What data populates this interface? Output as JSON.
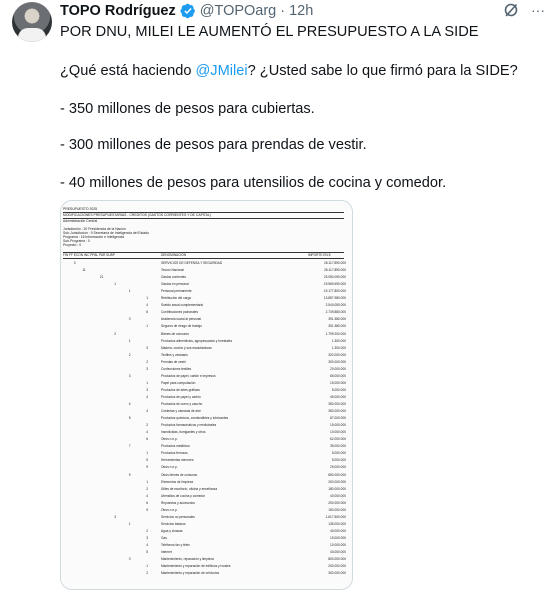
{
  "tweet": {
    "author_name": "TOPO Rodríguez",
    "handle": "@TOPOarg",
    "separator": "·",
    "time": "12h",
    "more_label": "···",
    "text": {
      "line1": "POR DNU, MILEI LE AUMENTÓ EL PRESUPUESTO A LA SIDE",
      "line2_a": "¿Qué está haciendo ",
      "line2_mention": "@JMilei",
      "line2_b": "? ¿Usted sabe lo que firmó para la SIDE?",
      "line3": "- 350 millones de pesos para cubiertas.",
      "line4": "- 300 millones de pesos para prendas de vestir.",
      "line5": "- 40 millones de pesos para utensilios de cocina y comedor."
    },
    "colors": {
      "mention": "#1d9bf0",
      "verified": "#1d9bf0",
      "muted": "#536471"
    }
  },
  "document": {
    "header": {
      "title": "PRESUPUESTO 2025",
      "subtitle": "MODIFICACIONES PRESUPUESTARIAS - CREDITOS (GASTOS CORRIENTES Y DE CAPITAL)",
      "admin": "Administración Central",
      "jurisdiccion": "Jurisdicción          :   20 Presidencia de la Nación",
      "subjurisdiccion": "Sub-Jurisdicción      :     9 Secretaría de Inteligencia del Estado",
      "programa": "Programa              :   16 Información e Inteligencia",
      "subprograma": "Sub-Programa          :     0",
      "proyecto": "Proyecto              :     0"
    },
    "columns": {
      "codes": "FIN  FF  ECON  INC  PPAL  PAR  SUBP",
      "denominacion": "DENOMINACIÓN",
      "importe": "IMPORTE EN $"
    },
    "rows": [
      {
        "code": "3",
        "indent": 6,
        "desc": "SERVICIOS DE DEFENSA Y SEGURIDAD",
        "amt": "26.117.890.000"
      },
      {
        "code": "11",
        "indent": 12,
        "desc": "Tesoro Nacional",
        "amt": "26.117.890.000"
      },
      {
        "code": "21",
        "indent": 24,
        "desc": "Gastos corrientes",
        "amt": "23.050.090.000"
      },
      {
        "code": "1",
        "indent": 34,
        "desc": "Gastos en personal",
        "amt": "19.569.690.000"
      },
      {
        "code": "1",
        "indent": 44,
        "desc": "Personal permanente",
        "amt": "19.177.800.000"
      },
      {
        "code": "1",
        "indent": 56,
        "desc": "Retribución del cargo",
        "amt": "13.857.980.000"
      },
      {
        "code": "4",
        "indent": 56,
        "desc": "Sueldo anual complementario",
        "amt": "2.540.050.000"
      },
      {
        "code": "6",
        "indent": 56,
        "desc": "Contribuciones patronales",
        "amt": "2.739.880.000"
      },
      {
        "code": "3",
        "indent": 44,
        "desc": "Asistencia social al personal",
        "amt": "391.380.000"
      },
      {
        "code": "1",
        "indent": 56,
        "desc": "Seguros de riesgo de trabajo",
        "amt": "391.380.000"
      },
      {
        "code": "2",
        "indent": 34,
        "desc": "Bienes de consumo",
        "amt": "1.799.200.000"
      },
      {
        "code": "1",
        "indent": 44,
        "desc": "Productos alimenticios, agropecuarios y forestales",
        "amt": "1.300.000"
      },
      {
        "code": "3",
        "indent": 56,
        "desc": "Madera, corcho y sus manufacturas",
        "amt": "1.300.000"
      },
      {
        "code": "2",
        "indent": 44,
        "desc": "Textiles y vestuario",
        "amt": "320.000.000"
      },
      {
        "code": "2",
        "indent": 56,
        "desc": "Prendas de vestir",
        "amt": "300.000.000"
      },
      {
        "code": "3",
        "indent": 56,
        "desc": "Confecciones textiles",
        "amt": "20.000.000"
      },
      {
        "code": "3",
        "indent": 44,
        "desc": "Productos de papel, cartón e impresos",
        "amt": "65.000.000"
      },
      {
        "code": "1",
        "indent": 56,
        "desc": "Papel para computación",
        "amt": "15.000.000"
      },
      {
        "code": "3",
        "indent": 56,
        "desc": "Productos de artes gráficas",
        "amt": "5.000.000"
      },
      {
        "code": "4",
        "indent": 56,
        "desc": "Productos de papel y cartón",
        "amt": "45.000.000"
      },
      {
        "code": "4",
        "indent": 44,
        "desc": "Productos de cuero y caucho",
        "amt": "350.000.000"
      },
      {
        "code": "4",
        "indent": 56,
        "desc": "Cubiertas y cámaras de aire",
        "amt": "350.000.000"
      },
      {
        "code": "5",
        "indent": 44,
        "desc": "Productos químicos, combustibles y lubricantes",
        "amt": "87.000.000"
      },
      {
        "code": "2",
        "indent": 56,
        "desc": "Productos farmacéuticos y medicinales",
        "amt": "15.000.000"
      },
      {
        "code": "4",
        "indent": 56,
        "desc": "Insecticidas, fumigantes y otros",
        "amt": "10.000.000"
      },
      {
        "code": "6",
        "indent": 56,
        "desc": "Otros n.e.p.",
        "amt": "62.000.000"
      },
      {
        "code": "7",
        "indent": 44,
        "desc": "Productos metálicos",
        "amt": "35.000.000"
      },
      {
        "code": "1",
        "indent": 56,
        "desc": "Productos ferrosos",
        "amt": "5.000.000"
      },
      {
        "code": "5",
        "indent": 56,
        "desc": "Herramientas menores",
        "amt": "5.000.000"
      },
      {
        "code": "9",
        "indent": 56,
        "desc": "Otros n.e.p.",
        "amt": "25.000.000"
      },
      {
        "code": "9",
        "indent": 44,
        "desc": "Otros bienes de consumo",
        "amt": "650.000.000"
      },
      {
        "code": "1",
        "indent": 56,
        "desc": "Elementos de limpieza",
        "amt": "200.000.000"
      },
      {
        "code": "2",
        "indent": 56,
        "desc": "Útiles de escritorio, oficina y enseñanza",
        "amt": "180.000.000"
      },
      {
        "code": "4",
        "indent": 56,
        "desc": "Utensilios de cocina y comedor",
        "amt": "40.000.000"
      },
      {
        "code": "6",
        "indent": 56,
        "desc": "Repuestos y accesorios",
        "amt": "200.000.000"
      },
      {
        "code": "9",
        "indent": 56,
        "desc": "Otros n.e.p.",
        "amt": "150.000.000"
      },
      {
        "code": "3",
        "indent": 34,
        "desc": "Servicios no personales",
        "amt": "1.617.500.000"
      },
      {
        "code": "1",
        "indent": 44,
        "desc": "Servicios básicos",
        "amt": "135.000.000"
      },
      {
        "code": "2",
        "indent": 56,
        "desc": "Agua y cloacas",
        "amt": "40.000.000"
      },
      {
        "code": "3",
        "indent": 56,
        "desc": "Gas",
        "amt": "15.000.000"
      },
      {
        "code": "4",
        "indent": 56,
        "desc": "Teléfonos fax y télex",
        "amt": "10.000.000"
      },
      {
        "code": "5",
        "indent": 56,
        "desc": "Internet",
        "amt": "40.000.000"
      },
      {
        "code": "3",
        "indent": 44,
        "desc": "Mantenimiento, reparación y limpieza",
        "amt": "800.000.000"
      },
      {
        "code": "1",
        "indent": 56,
        "desc": "Mantenimiento y reparación de edificios y locales",
        "amt": "200.000.000"
      },
      {
        "code": "2",
        "indent": 56,
        "desc": "Mantenimiento y reparación de vehículos",
        "amt": "300.000.000"
      }
    ]
  }
}
